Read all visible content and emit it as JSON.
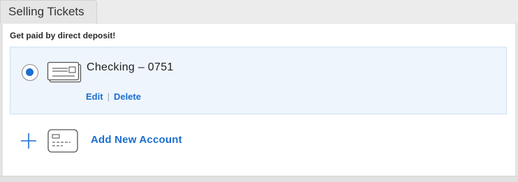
{
  "tab": {
    "label": "Selling Tickets"
  },
  "section": {
    "subtitle": "Get paid by direct deposit!"
  },
  "account": {
    "name": "Checking – 0751",
    "selected": true,
    "edit_label": "Edit",
    "separator": "|",
    "delete_label": "Delete",
    "icon": "check-icon"
  },
  "add_account": {
    "label": "Add New Account",
    "plus_icon": "plus-icon",
    "card_icon": "card-icon"
  },
  "colors": {
    "accent": "#1a6fd1",
    "selected_background": "#eef5fd",
    "page_background": "#e4e4e4"
  }
}
